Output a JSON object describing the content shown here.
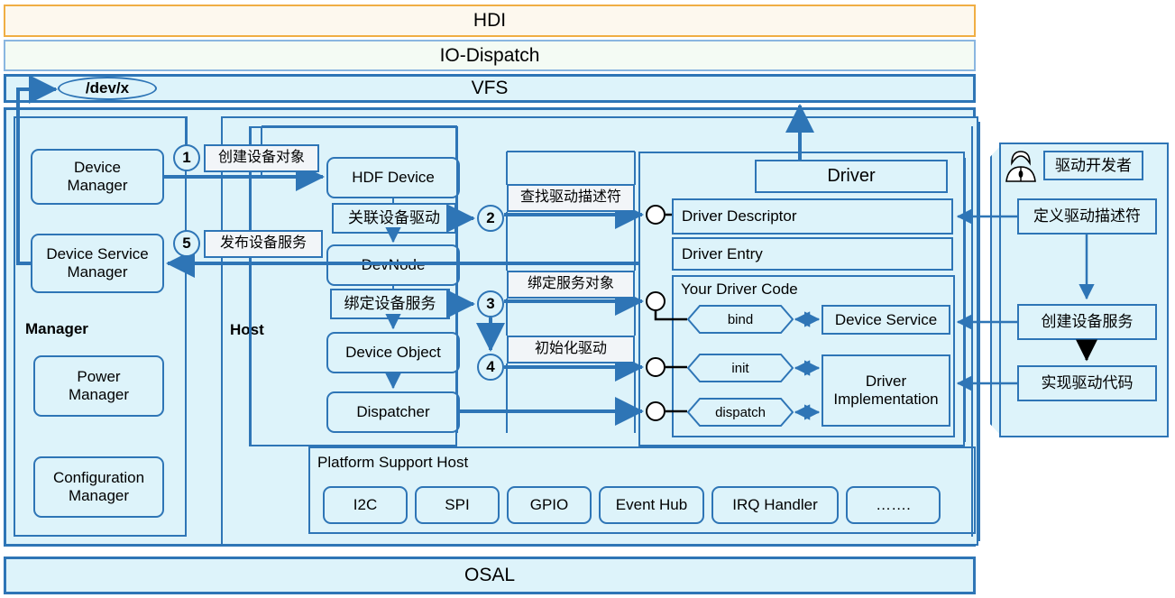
{
  "layers": {
    "hdi": "HDI",
    "io_dispatch": "IO-Dispatch",
    "vfs": "VFS",
    "osal": "OSAL",
    "devx": "/dev/x"
  },
  "manager": {
    "section_title": "Manager",
    "items": [
      "Device\nManager",
      "Device Service\nManager",
      "Power\nManager",
      "Configuration\nManager"
    ],
    "device_manager_line1": "Device",
    "device_manager_line2": "Manager",
    "device_service_manager_line1": "Device Service",
    "device_service_manager_line2": "Manager",
    "power_manager_line1": "Power",
    "power_manager_line2": "Manager",
    "configuration_manager_line1": "Configuration",
    "configuration_manager_line2": "Manager"
  },
  "host": {
    "section_title": "Host",
    "nodes": {
      "hdf_device": "HDF Device",
      "devnode": "DevNode",
      "device_object": "Device Object",
      "dispatcher": "Dispatcher"
    },
    "edge_labels": {
      "associate_driver": "关联设备驱动",
      "bind_device_service": "绑定设备服务"
    }
  },
  "steps": {
    "one": "1",
    "two": "2",
    "three": "3",
    "four": "4",
    "five": "5",
    "labels": {
      "create_device_object": "创建设备对象",
      "publish_device_service": "发布设备服务",
      "find_driver_descriptor": "查找驱动描述符",
      "bind_service_object": "绑定服务对象",
      "init_driver": "初始化驱动"
    }
  },
  "driver": {
    "title": "Driver",
    "descriptor": "Driver Descriptor",
    "entry": "Driver Entry",
    "your_code": "Your Driver Code",
    "hooks": [
      "bind",
      "init",
      "dispatch"
    ],
    "device_service": "Device Service",
    "implementation_line1": "Driver",
    "implementation_line2": "Implementation",
    "implementation": "Driver Implementation"
  },
  "platform": {
    "title": "Platform Support Host",
    "modules": [
      "I2C",
      "SPI",
      "GPIO",
      "Event Hub",
      "IRQ Handler",
      "……."
    ]
  },
  "developer": {
    "title": "驱动开发者",
    "steps": [
      "定义驱动描述符",
      "创建设备服务",
      "实现驱动代码"
    ],
    "step1": "定义驱动描述符",
    "step2": "创建设备服务",
    "step3": "实现驱动代码",
    "icon": "person-icon"
  },
  "colors": {
    "blue_border": "#2e75b6",
    "blue_fill": "#ddf3fa",
    "orange_border": "#f0ae44",
    "cream_fill": "#fdf8ee",
    "light_blue_border": "#8ab6e0",
    "label_fill": "#f2f5f8"
  }
}
